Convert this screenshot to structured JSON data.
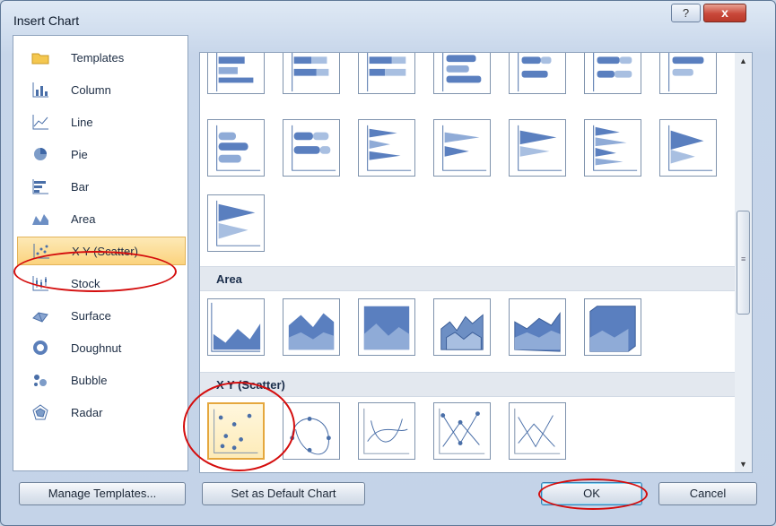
{
  "dialog": {
    "title": "Insert Chart",
    "help_glyph": "?",
    "close_glyph": "x"
  },
  "categories": [
    {
      "label": "Templates",
      "icon": "templates-folder-icon"
    },
    {
      "label": "Column",
      "icon": "column-chart-icon"
    },
    {
      "label": "Line",
      "icon": "line-chart-icon"
    },
    {
      "label": "Pie",
      "icon": "pie-chart-icon"
    },
    {
      "label": "Bar",
      "icon": "bar-chart-icon"
    },
    {
      "label": "Area",
      "icon": "area-chart-icon"
    },
    {
      "label": "X Y (Scatter)",
      "icon": "scatter-chart-icon",
      "selected": true
    },
    {
      "label": "Stock",
      "icon": "stock-chart-icon"
    },
    {
      "label": "Surface",
      "icon": "surface-chart-icon"
    },
    {
      "label": "Doughnut",
      "icon": "doughnut-chart-icon"
    },
    {
      "label": "Bubble",
      "icon": "bubble-chart-icon"
    },
    {
      "label": "Radar",
      "icon": "radar-chart-icon"
    }
  ],
  "gallery": {
    "sections": {
      "area": "Area",
      "scatter": "X Y (Scatter)"
    },
    "selected_thumbnail": "scatter-markers-only",
    "scroll_grip": "≡"
  },
  "buttons": {
    "manage_templates": "Manage Templates...",
    "set_default": "Set as Default Chart",
    "ok": "OK",
    "cancel": "Cancel"
  },
  "colors": {
    "selection_highlight": "#fbd37e",
    "annotation_circle": "#d40d0d",
    "chart_blue": "#4a6fa8"
  }
}
